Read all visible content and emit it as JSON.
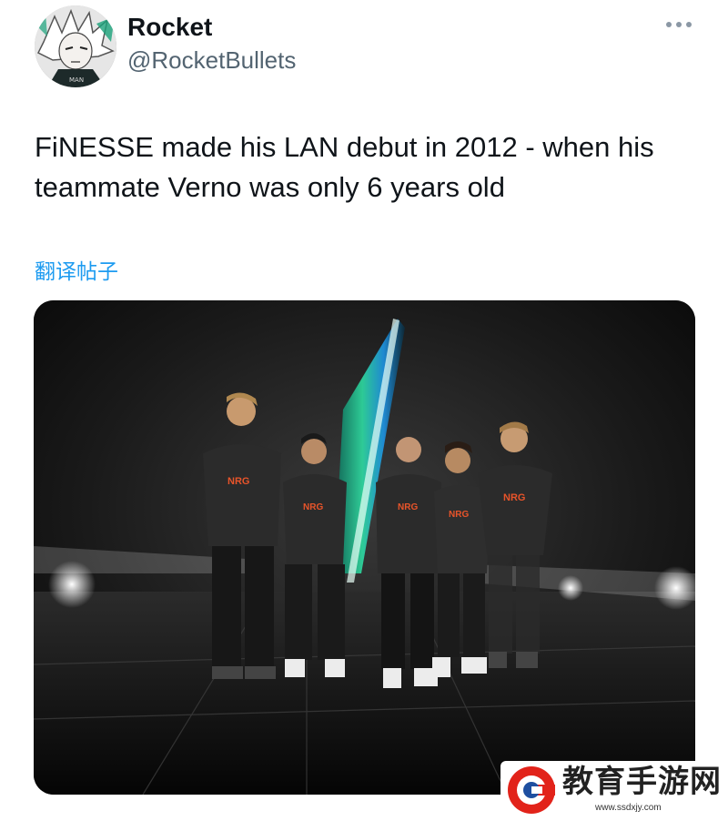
{
  "post": {
    "display_name": "Rocket",
    "handle": "@RocketBullets",
    "text": "FiNESSE made his LAN debut in 2012 - when his teammate Verno was only 6 years old",
    "translate_label": "翻译帖子",
    "more_icon": "more-horizontal-icon",
    "avatar_caption": "MAN"
  },
  "media": {
    "jersey_text": "NRG",
    "accent_colors": [
      "#e8542a",
      "#2ee6a8",
      "#1d9bf0"
    ]
  },
  "watermark": {
    "title": "教育手游网",
    "url": "www.ssdxjy.com",
    "logo_color": "#e2231a"
  }
}
